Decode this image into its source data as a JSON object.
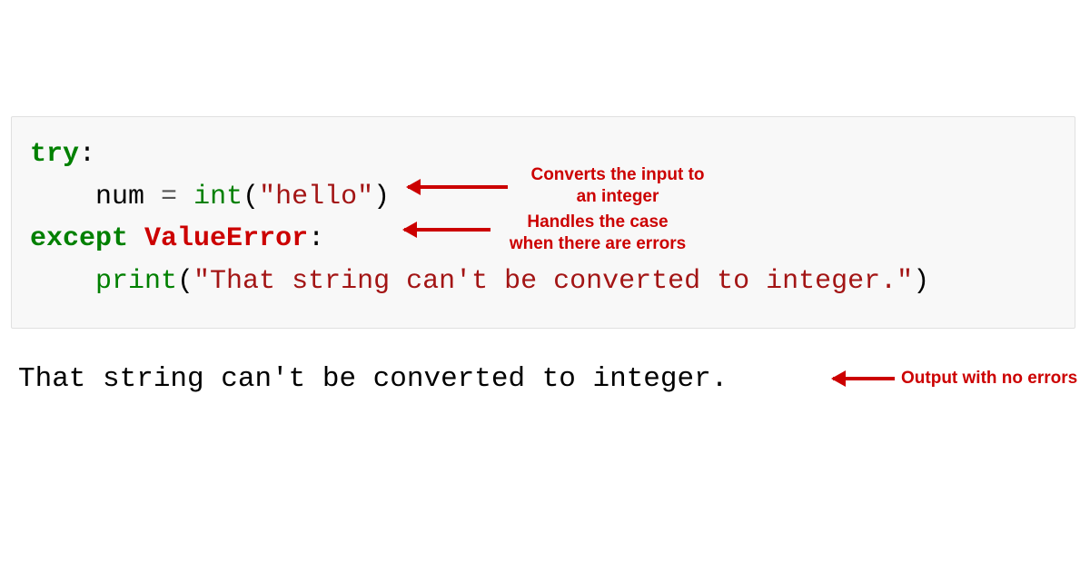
{
  "code": {
    "line1": {
      "try": "try",
      "colon": ":"
    },
    "line2": {
      "indent": "    ",
      "var": "num ",
      "op": "=",
      "sp": " ",
      "fn": "int",
      "open": "(",
      "str": "\"hello\"",
      "close": ")"
    },
    "line3": {
      "except": "except",
      "sp": " ",
      "err": "ValueError",
      "colon": ":"
    },
    "line4": {
      "indent": "    ",
      "fn": "print",
      "open": "(",
      "str": "\"That string can't be converted to integer.\"",
      "close": ")"
    }
  },
  "output": "That string can't be converted to integer.",
  "annotations": {
    "a1": "Converts the input to\nan integer",
    "a2": "Handles the case\nwhen there are errors",
    "a3": "Output with no errors"
  }
}
